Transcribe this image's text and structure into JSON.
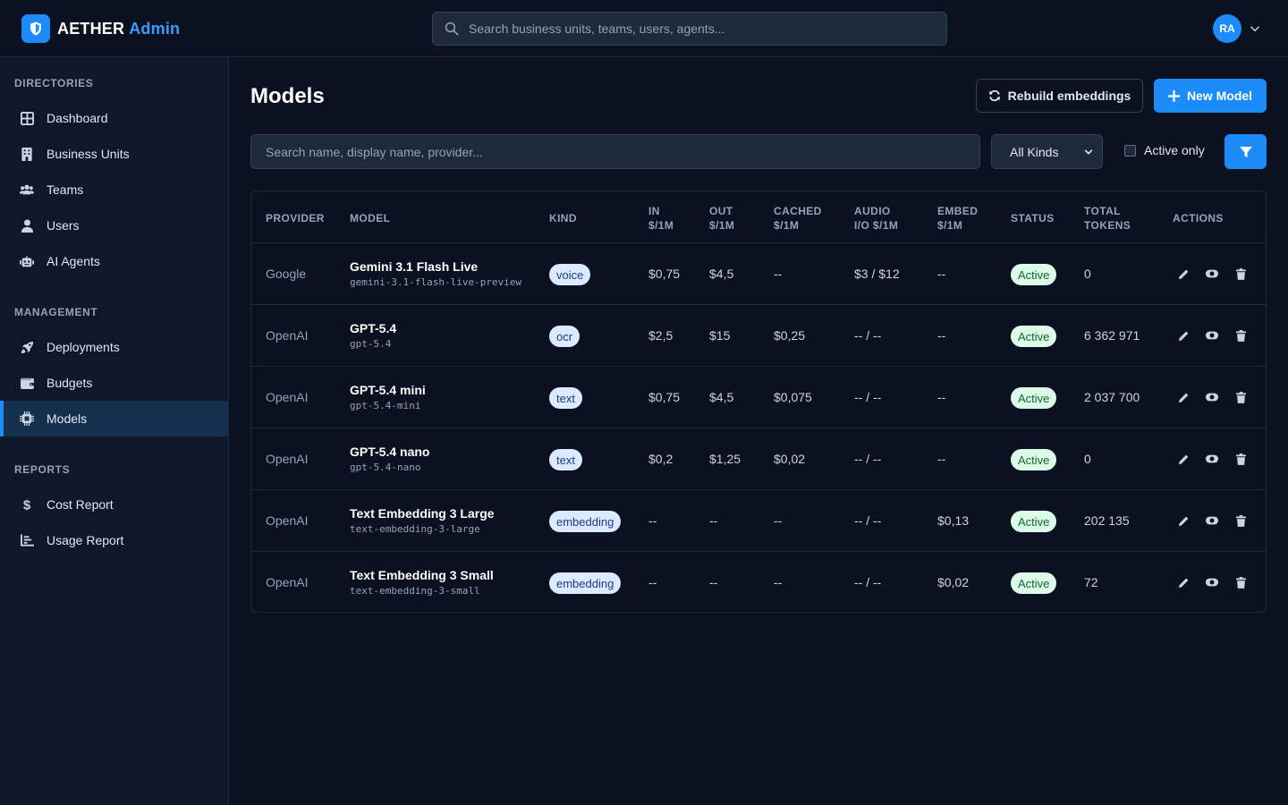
{
  "app": {
    "brand_main": "AETHER",
    "brand_sub": "Admin"
  },
  "header": {
    "search_placeholder": "Search business units, teams, users, agents...",
    "user_initials": "RA"
  },
  "sidebar": {
    "sections": [
      {
        "title": "DIRECTORIES",
        "items": [
          {
            "label": "Dashboard",
            "icon": "dashboard-icon"
          },
          {
            "label": "Business Units",
            "icon": "building-icon"
          },
          {
            "label": "Teams",
            "icon": "users-group-icon"
          },
          {
            "label": "Users",
            "icon": "user-icon"
          },
          {
            "label": "AI Agents",
            "icon": "robot-icon"
          }
        ]
      },
      {
        "title": "MANAGEMENT",
        "items": [
          {
            "label": "Deployments",
            "icon": "rocket-icon"
          },
          {
            "label": "Budgets",
            "icon": "wallet-icon"
          },
          {
            "label": "Models",
            "icon": "chip-icon",
            "active": true
          }
        ]
      },
      {
        "title": "REPORTS",
        "items": [
          {
            "label": "Cost Report",
            "icon": "dollar-icon"
          },
          {
            "label": "Usage Report",
            "icon": "chart-icon"
          }
        ]
      }
    ]
  },
  "page": {
    "title": "Models",
    "rebuild_label": "Rebuild embeddings",
    "new_label": "New Model",
    "search_placeholder": "Search name, display name, provider...",
    "kind_filter": "All Kinds",
    "active_only_label": "Active only"
  },
  "table": {
    "headers": {
      "provider": "PROVIDER",
      "model": "MODEL",
      "kind": "KIND",
      "in_1": "IN",
      "in_2": "$/1M",
      "out_1": "OUT",
      "out_2": "$/1M",
      "cached_1": "CACHED",
      "cached_2": "$/1M",
      "audio_1": "AUDIO",
      "audio_2": "I/O $/1M",
      "embed_1": "EMBED",
      "embed_2": "$/1M",
      "status": "STATUS",
      "tokens_1": "TOTAL",
      "tokens_2": "TOKENS",
      "actions": "ACTIONS"
    },
    "rows": [
      {
        "provider": "Google",
        "display_name": "Gemini 3.1 Flash Live",
        "model_id": "gemini-3.1-flash-live-preview",
        "kind": "voice",
        "in": "$0,75",
        "out": "$4,5",
        "cached": "--",
        "audio": "$3 / $12",
        "embed": "--",
        "status": "Active",
        "tokens": "0"
      },
      {
        "provider": "OpenAI",
        "display_name": "GPT-5.4",
        "model_id": "gpt-5.4",
        "kind": "ocr",
        "in": "$2,5",
        "out": "$15",
        "cached": "$0,25",
        "audio": "-- / --",
        "embed": "--",
        "status": "Active",
        "tokens": "6 362 971"
      },
      {
        "provider": "OpenAI",
        "display_name": "GPT-5.4 mini",
        "model_id": "gpt-5.4-mini",
        "kind": "text",
        "in": "$0,75",
        "out": "$4,5",
        "cached": "$0,075",
        "audio": "-- / --",
        "embed": "--",
        "status": "Active",
        "tokens": "2 037 700"
      },
      {
        "provider": "OpenAI",
        "display_name": "GPT-5.4 nano",
        "model_id": "gpt-5.4-nano",
        "kind": "text",
        "in": "$0,2",
        "out": "$1,25",
        "cached": "$0,02",
        "audio": "-- / --",
        "embed": "--",
        "status": "Active",
        "tokens": "0"
      },
      {
        "provider": "OpenAI",
        "display_name": "Text Embedding 3 Large",
        "model_id": "text-embedding-3-large",
        "kind": "embedding",
        "in": "--",
        "out": "--",
        "cached": "--",
        "audio": "-- / --",
        "embed": "$0,13",
        "status": "Active",
        "tokens": "202 135"
      },
      {
        "provider": "OpenAI",
        "display_name": "Text Embedding 3 Small",
        "model_id": "text-embedding-3-small",
        "kind": "embedding",
        "in": "--",
        "out": "--",
        "cached": "--",
        "audio": "-- / --",
        "embed": "$0,02",
        "status": "Active",
        "tokens": "72"
      }
    ]
  },
  "colors": {
    "accent": "#1d8cf8",
    "background": "#0b1120",
    "sidebar": "#0f172a",
    "active_badge_bg": "#dcfce7",
    "kind_badge_bg": "#dbeafe"
  }
}
